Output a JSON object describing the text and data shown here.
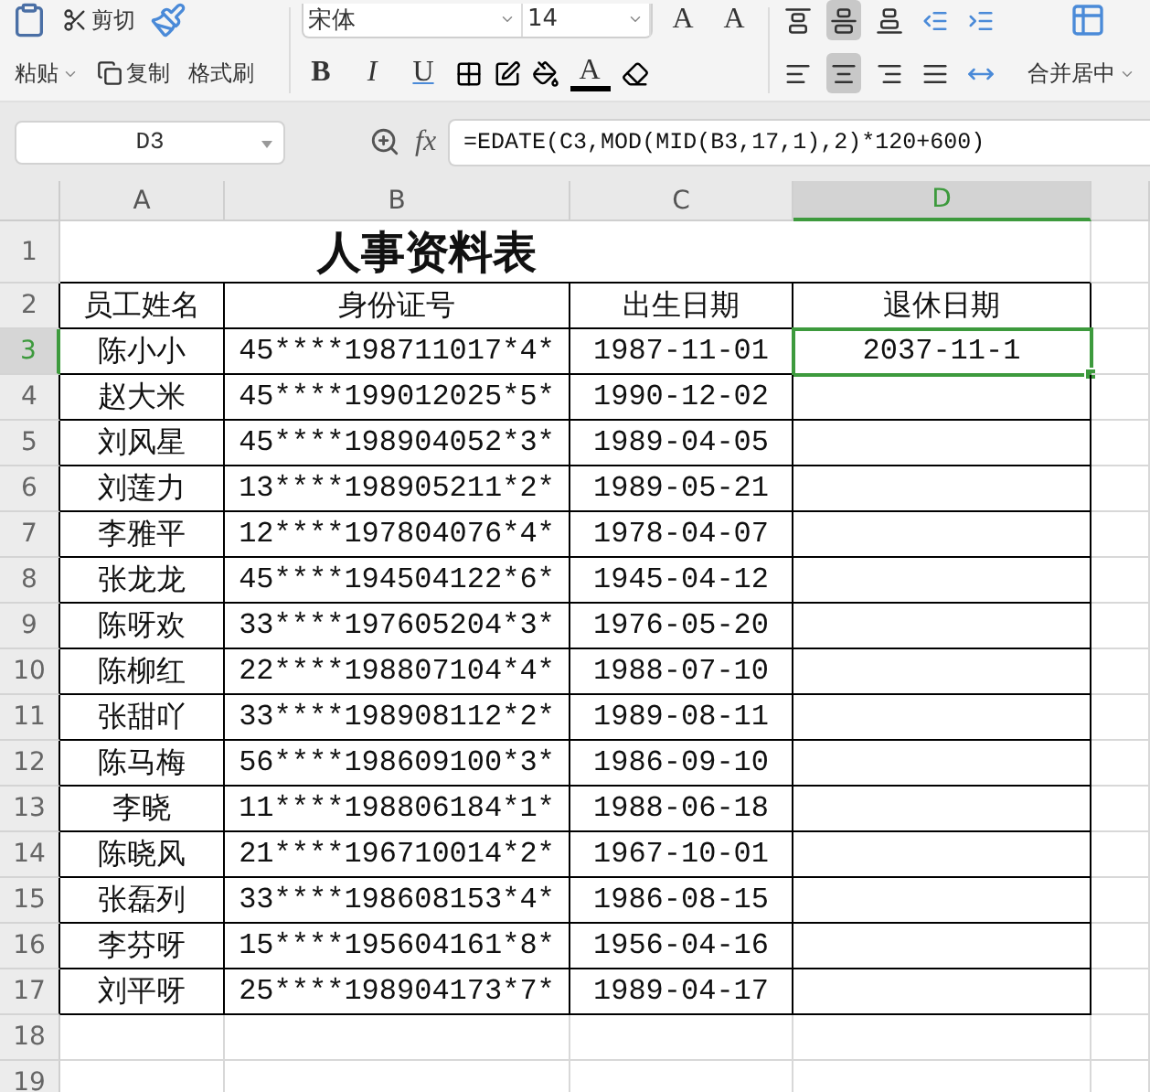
{
  "toolbar": {
    "paste": "粘贴",
    "cut": "剪切",
    "copy": "复制",
    "format_painter": "格式刷",
    "font_name": "宋体",
    "font_size": "14",
    "grow_font": "A",
    "shrink_font": "A",
    "bold": "B",
    "italic": "I",
    "underline": "U",
    "font_color": "A",
    "align_top": [
      {
        "kind": "top",
        "selected": false
      },
      {
        "kind": "middle",
        "selected": true
      },
      {
        "kind": "bottom",
        "selected": false
      },
      {
        "kind": "outdent",
        "selected": false
      },
      {
        "kind": "indent",
        "selected": false
      }
    ],
    "align_bottom": [
      {
        "kind": "left",
        "selected": false
      },
      {
        "kind": "center",
        "selected": true
      },
      {
        "kind": "right",
        "selected": false
      },
      {
        "kind": "justify",
        "selected": false
      },
      {
        "kind": "distribute",
        "selected": false
      }
    ],
    "merge": "合并居中"
  },
  "formula_bar": {
    "cell_ref": "D3",
    "fx_label": "fx",
    "formula": "=EDATE(C3,MOD(MID(B3,17,1),2)*120+600)"
  },
  "columns": [
    {
      "label": "A",
      "selected": false
    },
    {
      "label": "B",
      "selected": false
    },
    {
      "label": "C",
      "selected": false
    },
    {
      "label": "D",
      "selected": true
    }
  ],
  "sheet": {
    "title": "人事资料表",
    "headers": [
      "员工姓名",
      "身份证号",
      "出生日期",
      "退休日期"
    ],
    "rows": [
      {
        "number": "3",
        "selected": true,
        "cells": [
          {
            "text": "陈小小",
            "selected": false
          },
          {
            "text": "45****198711017*4*",
            "selected": false
          },
          {
            "text": "1987-11-01",
            "selected": false
          },
          {
            "text": "2037-11-1",
            "selected": true
          }
        ]
      },
      {
        "number": "4",
        "selected": false,
        "cells": [
          {
            "text": "赵大米",
            "selected": false
          },
          {
            "text": "45****199012025*5*",
            "selected": false
          },
          {
            "text": "1990-12-02",
            "selected": false
          },
          {
            "selected": false
          }
        ]
      },
      {
        "number": "5",
        "selected": false,
        "cells": [
          {
            "text": "刘风星",
            "selected": false
          },
          {
            "text": "45****198904052*3*",
            "selected": false
          },
          {
            "text": "1989-04-05",
            "selected": false
          },
          {
            "selected": false
          }
        ]
      },
      {
        "number": "6",
        "selected": false,
        "cells": [
          {
            "text": "刘莲力",
            "selected": false
          },
          {
            "text": "13****198905211*2*",
            "selected": false
          },
          {
            "text": "1989-05-21",
            "selected": false
          },
          {
            "selected": false
          }
        ]
      },
      {
        "number": "7",
        "selected": false,
        "cells": [
          {
            "text": "李雅平",
            "selected": false
          },
          {
            "text": "12****197804076*4*",
            "selected": false
          },
          {
            "text": "1978-04-07",
            "selected": false
          },
          {
            "selected": false
          }
        ]
      },
      {
        "number": "8",
        "selected": false,
        "cells": [
          {
            "text": "张龙龙",
            "selected": false
          },
          {
            "text": "45****194504122*6*",
            "selected": false
          },
          {
            "text": "1945-04-12",
            "selected": false
          },
          {
            "selected": false
          }
        ]
      },
      {
        "number": "9",
        "selected": false,
        "cells": [
          {
            "text": "陈呀欢",
            "selected": false
          },
          {
            "text": "33****197605204*3*",
            "selected": false
          },
          {
            "text": "1976-05-20",
            "selected": false
          },
          {
            "selected": false
          }
        ]
      },
      {
        "number": "10",
        "selected": false,
        "cells": [
          {
            "text": "陈柳红",
            "selected": false
          },
          {
            "text": "22****198807104*4*",
            "selected": false
          },
          {
            "text": "1988-07-10",
            "selected": false
          },
          {
            "selected": false
          }
        ]
      },
      {
        "number": "11",
        "selected": false,
        "cells": [
          {
            "text": "张甜吖",
            "selected": false
          },
          {
            "text": "33****198908112*2*",
            "selected": false
          },
          {
            "text": "1989-08-11",
            "selected": false
          },
          {
            "selected": false
          }
        ]
      },
      {
        "number": "12",
        "selected": false,
        "cells": [
          {
            "text": "陈马梅",
            "selected": false
          },
          {
            "text": "56****198609100*3*",
            "selected": false
          },
          {
            "text": "1986-09-10",
            "selected": false
          },
          {
            "selected": false
          }
        ]
      },
      {
        "number": "13",
        "selected": false,
        "cells": [
          {
            "text": "李晓",
            "selected": false
          },
          {
            "text": "11****198806184*1*",
            "selected": false
          },
          {
            "text": "1988-06-18",
            "selected": false
          },
          {
            "selected": false
          }
        ]
      },
      {
        "number": "14",
        "selected": false,
        "cells": [
          {
            "text": "陈晓风",
            "selected": false
          },
          {
            "text": "21****196710014*2*",
            "selected": false
          },
          {
            "text": "1967-10-01",
            "selected": false
          },
          {
            "selected": false
          }
        ]
      },
      {
        "number": "15",
        "selected": false,
        "cells": [
          {
            "text": "张磊列",
            "selected": false
          },
          {
            "text": "33****198608153*4*",
            "selected": false
          },
          {
            "text": "1986-08-15",
            "selected": false
          },
          {
            "selected": false
          }
        ]
      },
      {
        "number": "16",
        "selected": false,
        "cells": [
          {
            "text": "李芬呀",
            "selected": false
          },
          {
            "text": "15****195604161*8*",
            "selected": false
          },
          {
            "text": "1956-04-16",
            "selected": false
          },
          {
            "selected": false
          }
        ]
      },
      {
        "number": "17",
        "selected": false,
        "cells": [
          {
            "text": "刘平呀",
            "selected": false
          },
          {
            "text": "25****198904173*7*",
            "selected": false
          },
          {
            "text": "1989-04-17",
            "selected": false
          },
          {
            "selected": false
          }
        ]
      }
    ],
    "empty_rows": [
      "18",
      "19"
    ],
    "title_row_number": "1",
    "header_row_number": "2"
  }
}
